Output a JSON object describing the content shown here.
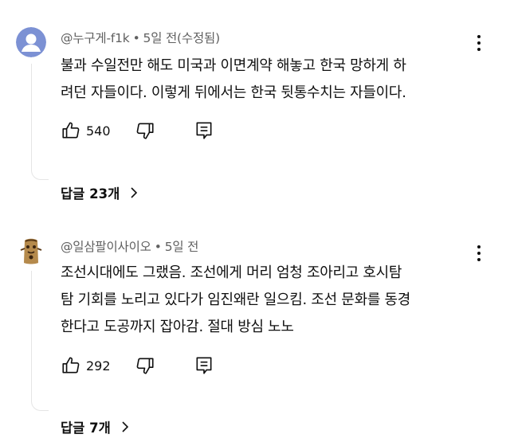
{
  "comments": [
    {
      "author": "@누구게-f1k",
      "time": "5일 전",
      "edited": "(수정됨)",
      "text_lines": [
        "불과 수일전만 해도  미국과 이면계약 해놓고 한국 망하게 하",
        "려던 자들이다. 이렇게 뒤에서는 한국 뒷통수치는 자들이다."
      ],
      "likes": "540",
      "replies_label": "답글 23개",
      "avatar": "default-person-avatar"
    },
    {
      "author": "@일삼팔이사이오",
      "time": "5일 전",
      "edited": "",
      "text_lines": [
        "조선시대에도 그랬음. 조선에게 머리 엄청 조아리고 호시탐",
        "탐 기회를 노리고 있다가 임진왜란 일으킴. 조선 문화를 동경",
        "한다고 도공까지 잡아감. 절대 방심 노노"
      ],
      "likes": "292",
      "replies_label": "답글 7개",
      "avatar": "cartoon-character-avatar"
    }
  ],
  "colors": {
    "text": "#0f0f0f",
    "secondary": "#606060",
    "avatar_bg": "#7c91d4",
    "thread": "#e5e5e5"
  }
}
